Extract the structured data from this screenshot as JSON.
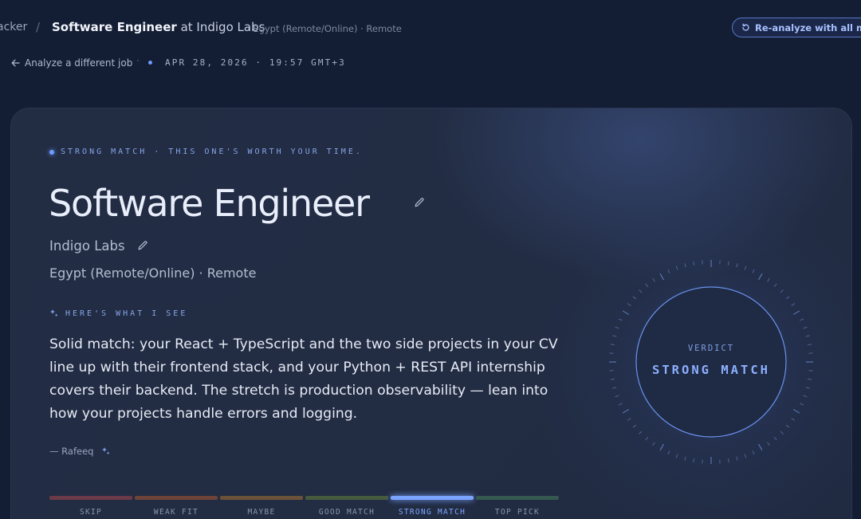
{
  "breadcrumb": {
    "previous": "acker",
    "separator": "/",
    "job_title": "Software Engineer",
    "at_company": "at Indigo Labs",
    "meta": "· Egypt (Remote/Online) · Remote"
  },
  "reanalyze_button": {
    "label": "Re-analyze with all my C",
    "icon": "refresh-icon"
  },
  "back_link": {
    "label": "Analyze a different job",
    "icon": "arrow-left-icon"
  },
  "timestamp": "APR 28, 2026 · 19:57 GMT+3",
  "card": {
    "kicker": "STRONG MATCH · THIS ONE'S WORTH YOUR TIME.",
    "title": "Software Engineer",
    "company": "Indigo Labs",
    "location": "Egypt (Remote/Online) · Remote",
    "section_heading": "HERE'S WHAT I SEE",
    "summary": "Solid match: your React + TypeScript and the two side projects in your CV line up with their frontend stack, and your Python + REST API internship covers their backend. The stretch is production observability — lean into how your projects handle errors and logging.",
    "signature": "— Rafeeq"
  },
  "verdict": {
    "caption": "VERDICT",
    "value": "STRONG MATCH"
  },
  "scale": {
    "selected": "STRONG MATCH",
    "levels": [
      {
        "label": "SKIP",
        "color": "#6b3a48"
      },
      {
        "label": "WEAK FIT",
        "color": "#6e4338"
      },
      {
        "label": "MAYBE",
        "color": "#6a5238"
      },
      {
        "label": "GOOD MATCH",
        "color": "#465a3e"
      },
      {
        "label": "STRONG MATCH",
        "color": "#7aa4ff"
      },
      {
        "label": "TOP PICK",
        "color": "#35584f"
      }
    ]
  },
  "colors": {
    "accent": "#6e9bff",
    "background": "#131d33",
    "card": "#222c43"
  }
}
